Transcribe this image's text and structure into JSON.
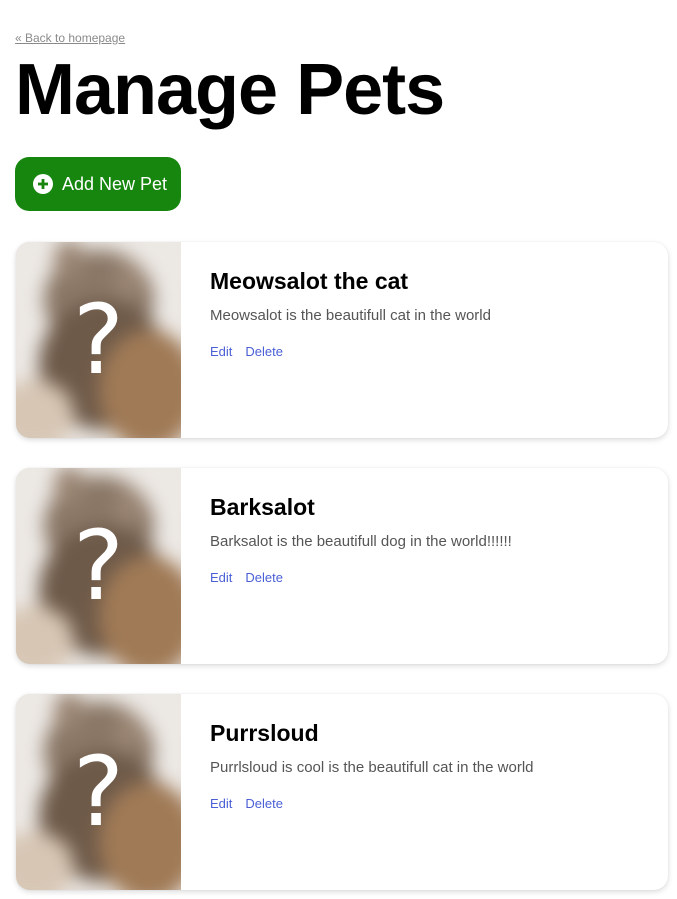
{
  "back_link": "« Back to homepage",
  "page_title": "Manage Pets",
  "add_button": {
    "label": "Add New Pet",
    "icon": "plus-circle-icon",
    "color": "#17860f"
  },
  "placeholder_glyph": "?",
  "pets": [
    {
      "name": "Meowsalot the cat",
      "description": "Meowsalot is the beautifull cat in the world",
      "edit_label": "Edit",
      "delete_label": "Delete"
    },
    {
      "name": "Barksalot",
      "description": "Barksalot is the beautifull dog in the world!!!!!!",
      "edit_label": "Edit",
      "delete_label": "Delete"
    },
    {
      "name": "Purrsloud",
      "description": "Purrlsloud is cool is the beautifull cat in the world",
      "edit_label": "Edit",
      "delete_label": "Delete"
    }
  ],
  "link_color": "#4a5fd6"
}
